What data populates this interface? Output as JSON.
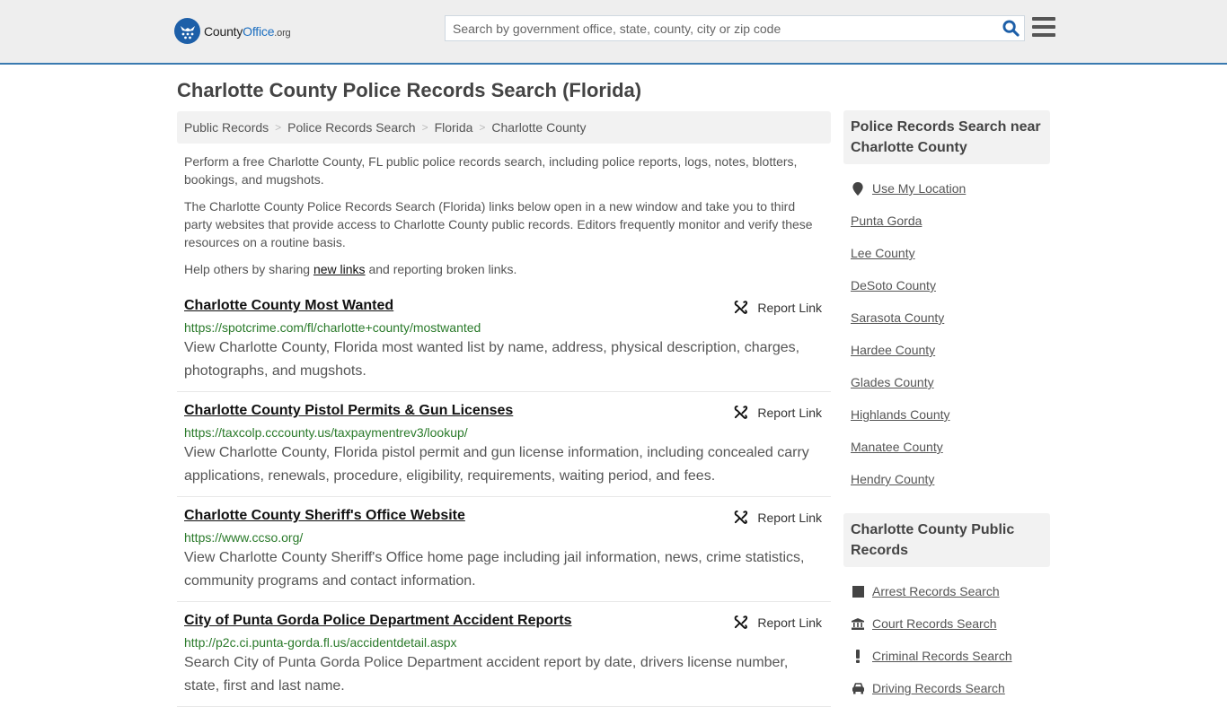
{
  "header": {
    "logo": {
      "brand_part1": "County",
      "brand_part2": "Office",
      "brand_tld": ".org"
    },
    "search": {
      "placeholder": "Search by government office, state, county, city or zip code",
      "value": ""
    },
    "colors": {
      "accent": "#3a7ab0",
      "logo_blue": "#1d5fa8",
      "url_green": "#2a7a2a"
    }
  },
  "page": {
    "title": "Charlotte County Police Records Search (Florida)"
  },
  "breadcrumb": [
    {
      "label": "Public Records"
    },
    {
      "label": "Police Records Search"
    },
    {
      "label": "Florida"
    },
    {
      "label": "Charlotte County"
    }
  ],
  "intro": {
    "p1": "Perform a free Charlotte County, FL public police records search, including police reports, logs, notes, blotters, bookings, and mugshots.",
    "p2": "The Charlotte County Police Records Search (Florida) links below open in a new window and take you to third party websites that provide access to Charlotte County public records. Editors frequently monitor and verify these resources on a routine basis.",
    "p3_before": "Help others by sharing ",
    "p3_link": "new links",
    "p3_after": " and reporting broken links."
  },
  "results": [
    {
      "title": "Charlotte County Most Wanted",
      "url": "https://spotcrime.com/fl/charlotte+county/mostwanted",
      "description": "View Charlotte County, Florida most wanted list by name, address, physical description, charges, photographs, and mugshots.",
      "report_label": "Report Link"
    },
    {
      "title": "Charlotte County Pistol Permits & Gun Licenses",
      "url": "https://taxcolp.cccounty.us/taxpaymentrev3/lookup/",
      "description": "View Charlotte County, Florida pistol permit and gun license information, including concealed carry applications, renewals, procedure, eligibility, requirements, waiting period, and fees.",
      "report_label": "Report Link"
    },
    {
      "title": "Charlotte County Sheriff's Office Website",
      "url": "https://www.ccso.org/",
      "description": "View Charlotte County Sheriff's Office home page including jail information, news, crime statistics, community programs and contact information.",
      "report_label": "Report Link"
    },
    {
      "title": "City of Punta Gorda Police Department Accident Reports",
      "url": "http://p2c.ci.punta-gorda.fl.us/accidentdetail.aspx",
      "description": "Search City of Punta Gorda Police Department accident report by date, drivers license number, state, first and last name.",
      "report_label": "Report Link"
    }
  ],
  "sidebar": {
    "nearby": {
      "heading": "Police Records Search near Charlotte County",
      "use_location": "Use My Location",
      "items": [
        "Punta Gorda",
        "Lee County",
        "DeSoto County",
        "Sarasota County",
        "Hardee County",
        "Glades County",
        "Highlands County",
        "Manatee County",
        "Hendry County"
      ]
    },
    "public_records": {
      "heading": "Charlotte County Public Records",
      "items": [
        {
          "label": "Arrest Records Search",
          "icon": "square-icon"
        },
        {
          "label": "Court Records Search",
          "icon": "courthouse-icon"
        },
        {
          "label": "Criminal Records Search",
          "icon": "exclamation-icon"
        },
        {
          "label": "Driving Records Search",
          "icon": "car-icon"
        }
      ]
    }
  }
}
